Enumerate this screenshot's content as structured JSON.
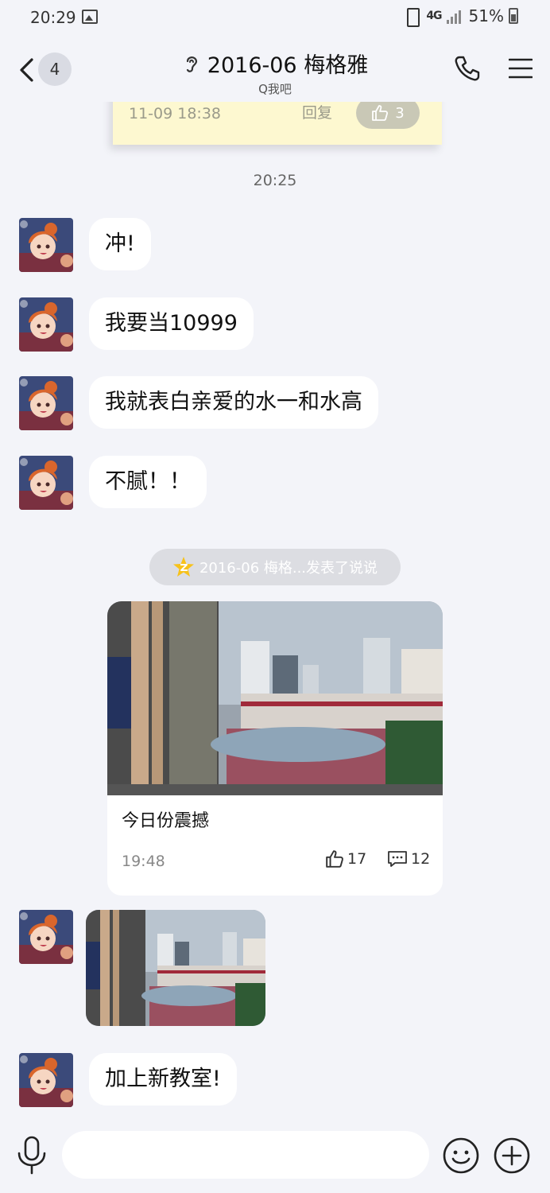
{
  "status_bar": {
    "time": "20:29",
    "network": "4G",
    "battery": "51%",
    "icons": [
      "image-icon",
      "vibrate-icon",
      "signal-icon",
      "battery-icon"
    ]
  },
  "header": {
    "back_badge": "4",
    "title": "2016-06 梅格雅",
    "subtitle": "Q我吧",
    "icons": [
      "back-icon",
      "ear-icon",
      "phone-icon",
      "menu-icon"
    ]
  },
  "note_card": {
    "time": "11-09 18:38",
    "reply": "回复",
    "likes": "3"
  },
  "timestamp": "20:25",
  "messages": [
    {
      "text": "冲!"
    },
    {
      "text": "我要当10999"
    },
    {
      "text": "我就表白亲爱的水一和水高"
    },
    {
      "text": "不腻！！"
    }
  ],
  "system_notice": "2016-06 梅格...发表了说说",
  "qzone_post": {
    "text": "今日份震撼",
    "time": "19:48",
    "likes": "17",
    "comments": "12"
  },
  "last_message": {
    "text": "加上新教室!"
  },
  "input": {
    "placeholder": ""
  },
  "colors": {
    "background": "#f3f4f9",
    "bubble": "#ffffff",
    "note": "#fdf8d0",
    "pill": "#dcdde2"
  }
}
